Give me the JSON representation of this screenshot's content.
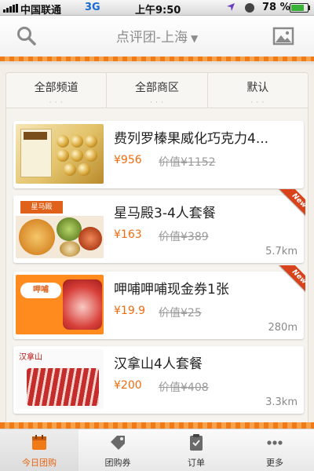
{
  "status_bar": {
    "carrier": "中国联通",
    "network": "3G",
    "time": "上午9:50",
    "battery": "78 %",
    "battery_level": 0.78
  },
  "header": {
    "city_title": "点评团-上海",
    "icons": {
      "search": "search-icon",
      "image": "image-icon",
      "caret": "caret-down-icon"
    }
  },
  "filters": [
    {
      "label": "全部频道"
    },
    {
      "label": "全部商区"
    },
    {
      "label": "默认"
    }
  ],
  "deals": [
    {
      "title": "费列罗榛果威化巧克力4...",
      "price": "¥956",
      "original": "价值¥1152",
      "distance": "",
      "new_badge": ""
    },
    {
      "title": "星马殿3-4人套餐",
      "price": "¥163",
      "original": "价值¥389",
      "distance": "5.7km",
      "new_badge": "New"
    },
    {
      "title": "呷哺呷哺现金券1张",
      "price": "¥19.9",
      "original": "价值¥25",
      "distance": "280m",
      "new_badge": "New"
    },
    {
      "title": "汉拿山4人套餐",
      "price": "¥200",
      "original": "价值¥408",
      "distance": "3.3km",
      "new_badge": ""
    }
  ],
  "thumb_text": {
    "star_logo": "星马殿",
    "food_logo": "呷哺",
    "meat_logo": "汉拿山"
  },
  "tabs": [
    {
      "label": "今日团购",
      "icon": "calendar-icon",
      "active": true
    },
    {
      "label": "团购券",
      "icon": "coupon-tag-icon",
      "active": false
    },
    {
      "label": "订单",
      "icon": "clipboard-icon",
      "active": false
    },
    {
      "label": "更多",
      "icon": "more-dots-icon",
      "active": false
    }
  ],
  "colors": {
    "accent": "#f07a18",
    "price": "#f06c0f",
    "ribbon": "#d9431c"
  }
}
